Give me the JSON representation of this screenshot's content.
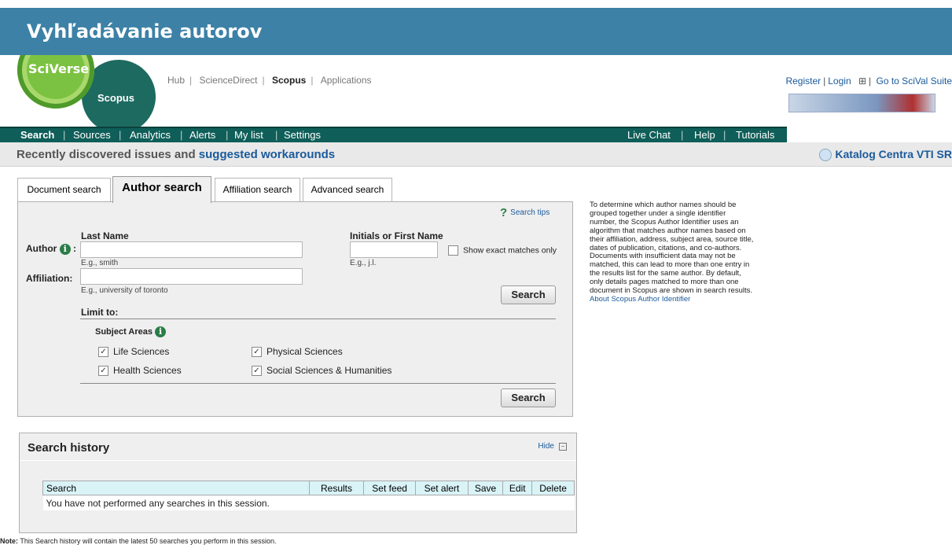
{
  "banner": {
    "title": "Vyhľadávanie autorov"
  },
  "logos": {
    "sciverse": "SciVerse",
    "scopus": "Scopus"
  },
  "top_nav": {
    "items": [
      "Hub",
      "ScienceDirect",
      "Scopus",
      "Applications"
    ],
    "active": "Scopus"
  },
  "top_links": {
    "register": "Register",
    "login": "Login",
    "go_to": "Go to SciVal Suite"
  },
  "main_nav": {
    "items": [
      "Search",
      "Sources",
      "Analytics",
      "Alerts",
      "My list",
      "Settings"
    ],
    "right_items": [
      "Live Chat",
      "Help",
      "Tutorials"
    ]
  },
  "notice": {
    "text": "Recently discovered issues and ",
    "link": "suggested workarounds",
    "catalog": "Katalog Centra VTI SR"
  },
  "tabs": [
    "Document search",
    "Author search",
    "Affiliation search",
    "Advanced search"
  ],
  "form": {
    "search_tips": "Search tips",
    "last_name_label": "Last Name",
    "author_label": "Author",
    "last_name_hint": "E.g., smith",
    "initials_label": "Initials or First Name",
    "initials_hint": "E.g., j.l.",
    "exact_label": "Show exact matches only",
    "affiliation_label": "Affiliation:",
    "affiliation_hint": "E.g., university of toronto",
    "search_button": "Search",
    "limit_to": "Limit to:",
    "subject_areas": "Subject Areas",
    "subjects": [
      "Life Sciences",
      "Physical Sciences",
      "Health Sciences",
      "Social Sciences & Humanities"
    ]
  },
  "sidebar": {
    "text": "To determine which author names should be grouped together under a single identifier number, the Scopus Author Identifier uses an algorithm that matches author names based on their affiliation, address, subject area, source title, dates of publication, citations, and co-authors. Documents with insufficient data may not be matched, this can lead to more than one entry in the results list for the same author. By default, only details pages matched to more than one document in Scopus are shown in search results.",
    "link": "About Scopus Author Identifier"
  },
  "history": {
    "title": "Search history",
    "hide": "Hide",
    "columns": [
      "Search",
      "Results",
      "Set feed",
      "Set alert",
      "Save",
      "Edit",
      "Delete"
    ],
    "empty": "You have not performed any searches in this session.",
    "note_label": "Note:",
    "note_text": "This Search history will contain the latest 50 searches you perform in this session."
  }
}
